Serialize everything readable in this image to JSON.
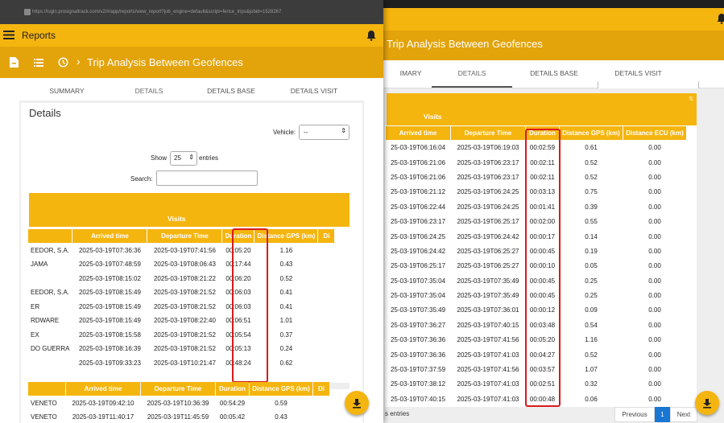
{
  "url": "https://login.prosignaltrack.com/v2/#/app/reports/view_report?job_engine=default&script=fence_trips&jobid=1528267",
  "left": {
    "app_title": "Reports",
    "breadcrumb": "Trip Analysis Between Geofences",
    "tabs": [
      "SUMMARY",
      "DETAILS",
      "DETAILS BASE",
      "DETAILS VISIT"
    ],
    "details_title": "Details",
    "vehicle_label": "Vehicle:",
    "vehicle_value": "--",
    "show_label": "Show",
    "show_value": "25",
    "entries_label": "entries",
    "search_label": "Search:",
    "table1_caption": "Visits",
    "table1_headers": [
      "",
      "Arrived time",
      "Departure Time",
      "Duration",
      "Distance GPS (km)",
      "Di"
    ],
    "table1_rows": [
      [
        "EEDOR, S.A.",
        "2025-03-19T07:36:36",
        "2025-03-19T07:41:56",
        "00:05:20",
        "1.16"
      ],
      [
        "JAMA",
        "2025-03-19T07:48:59",
        "2025-03-19T08:06:43",
        "00:17:44",
        "0.43"
      ],
      [
        "",
        "2025-03-19T08:15:02",
        "2025-03-19T08:21:22",
        "00:06:20",
        "0.52"
      ],
      [
        "EEDOR, S.A.",
        "2025-03-19T08:15:49",
        "2025-03-19T08:21:52",
        "00:06:03",
        "0.41"
      ],
      [
        "ER",
        "2025-03-19T08:15:49",
        "2025-03-19T08:21:52",
        "00:06:03",
        "0.41"
      ],
      [
        "RDWARE",
        "2025-03-19T08:15:49",
        "2025-03-19T08:22:40",
        "00:06:51",
        "1.01"
      ],
      [
        "EX",
        "2025-03-19T08:15:58",
        "2025-03-19T08:21:52",
        "00:05:54",
        "0.37"
      ],
      [
        "DO GUERRA",
        "2025-03-19T08:16:39",
        "2025-03-19T08:21:52",
        "00:05:13",
        "0.24"
      ],
      [
        "",
        "2025-03-19T09:33:23",
        "2025-03-19T10:21:47",
        "00:48:24",
        "0.62"
      ]
    ],
    "table2_headers": [
      "",
      "Arrived time",
      "Departure Time",
      "Duration",
      "Distance GPS (km)",
      "Di"
    ],
    "table2_rows": [
      [
        "VENETO",
        "2025-03-19T09:42:10",
        "2025-03-19T10:36:39",
        "00:54:29",
        "0.59"
      ],
      [
        "VENETO",
        "2025-03-19T11:40:17",
        "2025-03-19T11:45:59",
        "00:05:42",
        "0.43"
      ]
    ]
  },
  "right": {
    "breadcrumb": "Trip Analysis Between Geofences",
    "tabs": [
      "IMARY",
      "DETAILS",
      "DETAILS BASE",
      "DETAILS VISIT"
    ],
    "table_caption": "Visits",
    "headers": [
      "Arrived time",
      "Departure Time",
      "Duration",
      "Distance GPS (km)",
      "Distance ECU (km)"
    ],
    "rows": [
      [
        "25-03-19T06:16:04",
        "2025-03-19T06:19:03",
        "00:02:59",
        "0.61",
        "0.00"
      ],
      [
        "25-03-19T06:21:06",
        "2025-03-19T06:23:17",
        "00:02:11",
        "0.52",
        "0.00"
      ],
      [
        "25-03-19T06:21:06",
        "2025-03-19T06:23:17",
        "00:02:11",
        "0.52",
        "0.00"
      ],
      [
        "25-03-19T06:21:12",
        "2025-03-19T06:24:25",
        "00:03:13",
        "0.75",
        "0.00"
      ],
      [
        "25-03-19T06:22:44",
        "2025-03-19T06:24:25",
        "00:01:41",
        "0.39",
        "0.00"
      ],
      [
        "25-03-19T06:23:17",
        "2025-03-19T06:25:17",
        "00:02:00",
        "0.55",
        "0.00"
      ],
      [
        "25-03-19T06:24:25",
        "2025-03-19T06:24:42",
        "00:00:17",
        "0.14",
        "0.00"
      ],
      [
        "25-03-19T06:24:42",
        "2025-03-19T06:25:27",
        "00:00:45",
        "0.19",
        "0.00"
      ],
      [
        "25-03-19T06:25:17",
        "2025-03-19T06:25:27",
        "00:00:10",
        "0.05",
        "0.00"
      ],
      [
        "25-03-19T07:35:04",
        "2025-03-19T07:35:49",
        "00:00:45",
        "0.25",
        "0.00"
      ],
      [
        "25-03-19T07:35:04",
        "2025-03-19T07:35:49",
        "00:00:45",
        "0.25",
        "0.00"
      ],
      [
        "25-03-19T07:35:49",
        "2025-03-19T07:36:01",
        "00:00:12",
        "0.09",
        "0.00"
      ],
      [
        "25-03-19T07:36:27",
        "2025-03-19T07:40:15",
        "00:03:48",
        "0.54",
        "0.00"
      ],
      [
        "25-03-19T07:36:36",
        "2025-03-19T07:41:56",
        "00:05:20",
        "1.16",
        "0.00"
      ],
      [
        "25-03-19T07:36:36",
        "2025-03-19T07:41:03",
        "00:04:27",
        "0.52",
        "0.00"
      ],
      [
        "25-03-19T07:37:59",
        "2025-03-19T07:41:56",
        "00:03:57",
        "1.07",
        "0.00"
      ],
      [
        "25-03-19T07:38:12",
        "2025-03-19T07:41:03",
        "00:02:51",
        "0.32",
        "0.00"
      ],
      [
        "25-03-19T07:40:15",
        "2025-03-19T07:41:03",
        "00:00:48",
        "0.06",
        "0.00"
      ]
    ],
    "entries_text": "s entries",
    "pager": {
      "previous": "Previous",
      "page": "1",
      "next": "Next"
    }
  },
  "colors": {
    "accent": "#f5b50f",
    "accent_dark": "#e3a30a",
    "highlight": "#d81b1b",
    "page_active": "#1976d2"
  }
}
